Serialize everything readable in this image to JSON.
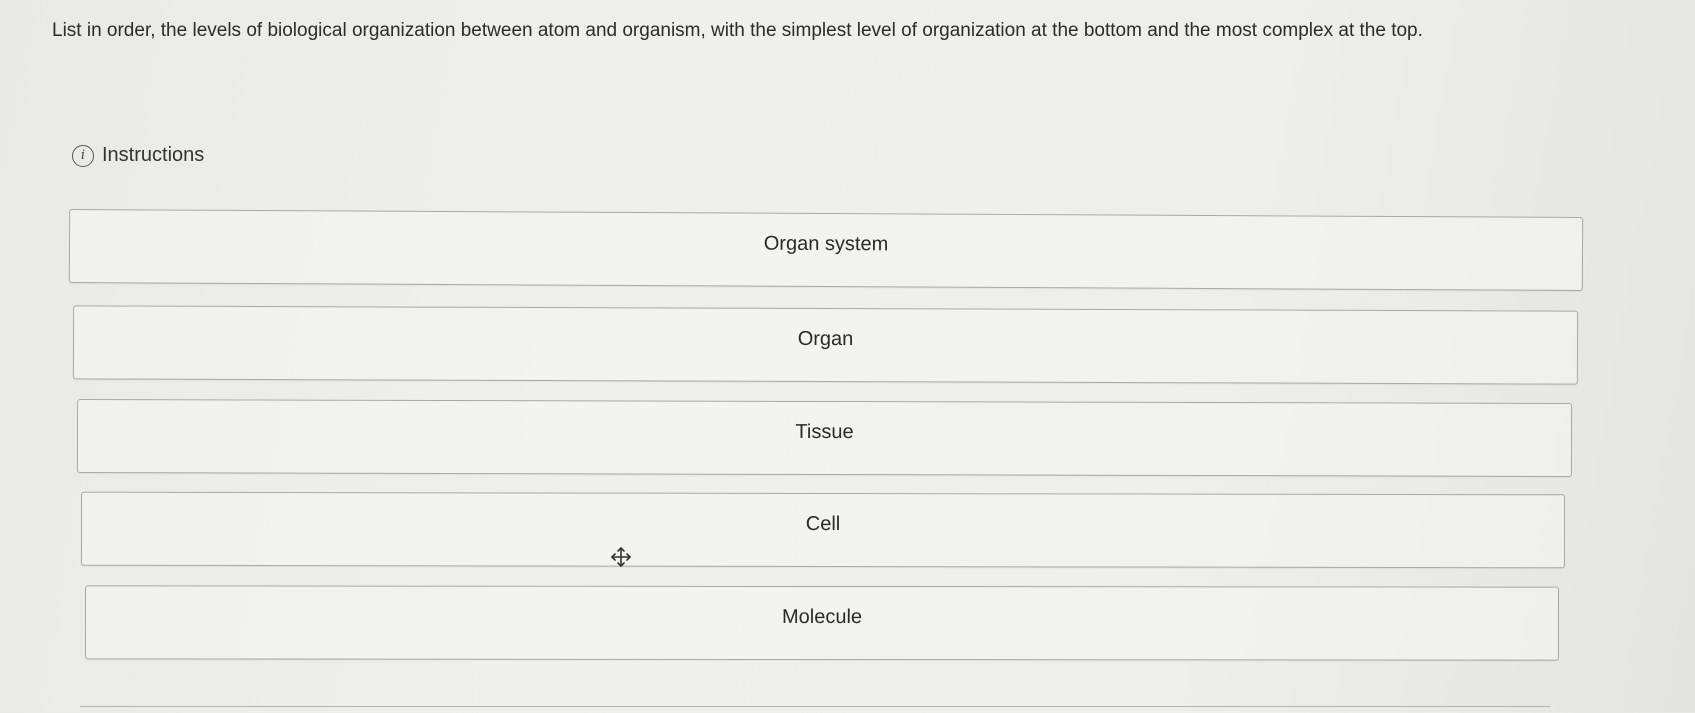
{
  "question": {
    "text": "List in order, the levels of biological organization between atom and organism, with the simplest level of organization at the bottom and the most complex at the top."
  },
  "instructions": {
    "label": "Instructions",
    "icon": "info-icon"
  },
  "ranking": {
    "items": [
      {
        "label": "Organ system"
      },
      {
        "label": "Organ"
      },
      {
        "label": "Tissue"
      },
      {
        "label": "Cell"
      },
      {
        "label": "Molecule"
      }
    ]
  },
  "cursor": {
    "icon": "move-cursor-icon"
  }
}
